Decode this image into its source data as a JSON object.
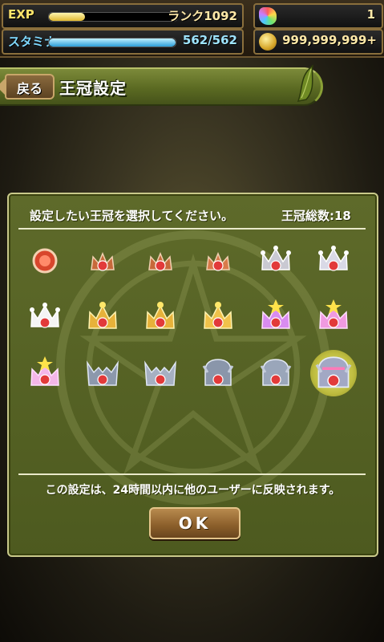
{
  "status": {
    "exp_label": "EXP",
    "exp_progress": 0.28,
    "rank_text": "ランク1092",
    "stamina_label": "スタミナ",
    "stamina_progress": 1.0,
    "stamina_text": "562/562",
    "magic_stones": "1",
    "coins": "999,999,999+"
  },
  "header": {
    "back_label": "戻る",
    "title": "王冠設定"
  },
  "panel": {
    "instruction": "設定したい王冠を選択してください。",
    "count_label": "王冠総数:18",
    "notice": "この設定は、24時間以内に他のユーザーに反映されます。",
    "ok_label": "OK"
  },
  "crowns": [
    {
      "name": "crown-1",
      "style": "orb",
      "color": "#d8462c"
    },
    {
      "name": "crown-2",
      "style": "small",
      "color": "#c7693a"
    },
    {
      "name": "crown-3",
      "style": "small",
      "color": "#c7693a"
    },
    {
      "name": "crown-4",
      "style": "small-gem",
      "color": "#d87a4a"
    },
    {
      "name": "crown-5",
      "style": "spiky",
      "color": "#c9c9d2"
    },
    {
      "name": "crown-6",
      "style": "spiky",
      "color": "#d9d9e6"
    },
    {
      "name": "crown-7",
      "style": "spiky",
      "color": "#f4f4f4"
    },
    {
      "name": "crown-8",
      "style": "gold",
      "color": "#e7b23a"
    },
    {
      "name": "crown-9",
      "style": "gold",
      "color": "#e7b23a"
    },
    {
      "name": "crown-10",
      "style": "gold",
      "color": "#f0c24a"
    },
    {
      "name": "crown-11",
      "style": "rainbow",
      "color": "#d98cf0"
    },
    {
      "name": "crown-12",
      "style": "rainbow",
      "color": "#f09ae0"
    },
    {
      "name": "crown-13",
      "style": "rainbow",
      "color": "#f4b6e8"
    },
    {
      "name": "crown-14",
      "style": "horned",
      "color": "#8c98ac"
    },
    {
      "name": "crown-15",
      "style": "horned",
      "color": "#a6b0c2"
    },
    {
      "name": "crown-16",
      "style": "helm",
      "color": "#8a96aa"
    },
    {
      "name": "crown-17",
      "style": "helm",
      "color": "#9aa6ba"
    },
    {
      "name": "crown-18",
      "style": "helm-jewel",
      "color": "#a2a8c4",
      "selected": true
    }
  ]
}
